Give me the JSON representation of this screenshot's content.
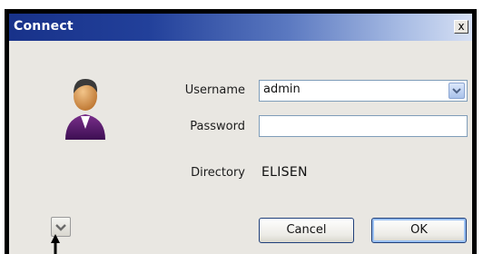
{
  "window": {
    "title": "Connect",
    "close_label": "x"
  },
  "form": {
    "username_label": "Username",
    "username_value": "admin",
    "password_label": "Password",
    "password_value": "",
    "directory_label": "Directory",
    "directory_value": "ELISEN"
  },
  "buttons": {
    "cancel_label": "Cancel",
    "ok_label": "OK"
  },
  "icons": {
    "avatar": "user-icon",
    "combo": "chevron-down-icon",
    "expand": "chevron-down-icon",
    "annotation": "arrow-up-icon"
  },
  "colors": {
    "title_start": "#18328a",
    "title_end": "#d6e0f4",
    "window_bg": "#e9e7e2",
    "button_border": "#1f3f7a",
    "ok_focus": "#9ac0f2"
  }
}
